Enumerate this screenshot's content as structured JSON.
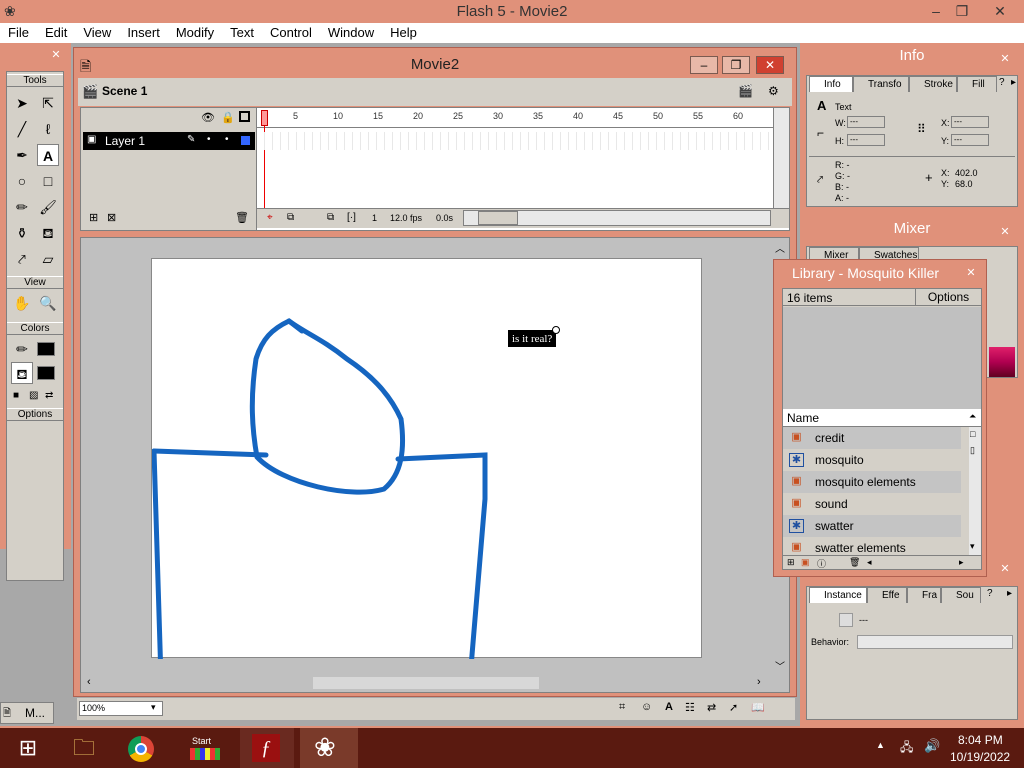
{
  "window": {
    "title": "Flash 5 - Movie2",
    "min": "‒",
    "max": "❐",
    "close": "✕"
  },
  "menu": [
    "File",
    "Edit",
    "View",
    "Insert",
    "Modify",
    "Text",
    "Control",
    "Window",
    "Help"
  ],
  "tools": {
    "header": "Tools",
    "view_label": "View",
    "colors_label": "Colors",
    "options_label": "Options"
  },
  "movie": {
    "title": "Movie2",
    "scene": "Scene 1",
    "layer": "Layer 1",
    "ruler": [
      "5",
      "10",
      "15",
      "20",
      "25",
      "30",
      "35",
      "40",
      "45",
      "50",
      "55",
      "60"
    ],
    "frame": "1",
    "fps": "12.0 fps",
    "time": "0.0s",
    "zoom": "100%",
    "stage_text": "is it real?"
  },
  "info": {
    "title": "Info",
    "tabs": [
      "Info",
      "Transfo",
      "Stroke",
      "Fill"
    ],
    "type_label": "Text",
    "w_label": "W:",
    "w_value": "---",
    "h_label": "H:",
    "h_value": "---",
    "x_label": "X:",
    "x_value": "---",
    "y_label": "Y:",
    "y_value": "---",
    "r": "R: -",
    "g": "G: -",
    "b": "B: -",
    "a": "A: -",
    "cx_label": "X:",
    "cx_value": "402.0",
    "cy_label": "Y:",
    "cy_value": "68.0"
  },
  "mixer": {
    "title": "Mixer",
    "tabs": [
      "Mixer",
      "Swatches"
    ]
  },
  "library": {
    "title": "Library - Mosquito Killer",
    "count": "16 items",
    "options": "Options",
    "name_header": "Name",
    "items": [
      {
        "name": "credit",
        "icon": "movieclip-icon"
      },
      {
        "name": "mosquito",
        "icon": "graphic-icon"
      },
      {
        "name": "mosquito elements",
        "icon": "movieclip-icon"
      },
      {
        "name": "sound",
        "icon": "movieclip-icon"
      },
      {
        "name": "swatter",
        "icon": "graphic-icon"
      },
      {
        "name": "swatter elements",
        "icon": "movieclip-icon"
      }
    ]
  },
  "instance": {
    "tabs": [
      "Instance",
      "Effe",
      "Fra",
      "Sou"
    ],
    "dash": "---",
    "behavior_label": "Behavior:"
  },
  "taskbar": {
    "minimized": "M...",
    "start_label": "Start",
    "time": "8:04 PM",
    "date": "10/19/2022"
  },
  "colors": {
    "frame": "#e0917a",
    "stroke": "#1565c0",
    "taskbar": "#5a1a10"
  }
}
